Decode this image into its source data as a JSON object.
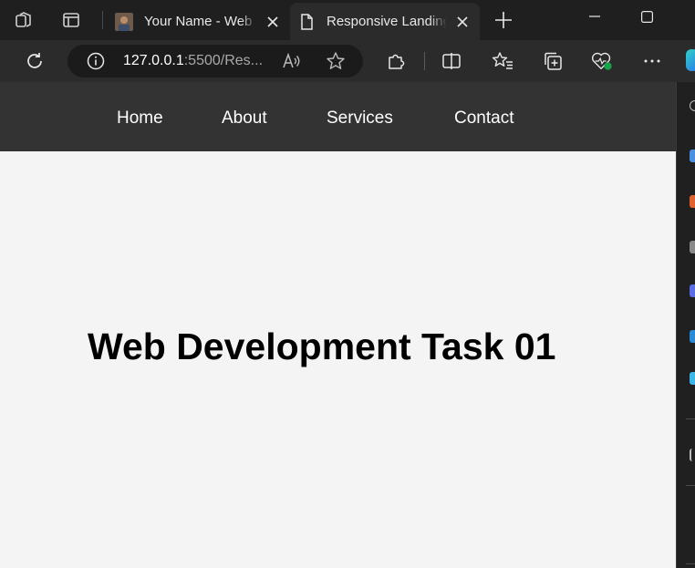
{
  "browser": {
    "tabs": [
      {
        "title": "Your Name - Web Developer",
        "active": false
      },
      {
        "title": "Responsive Landing Page",
        "active": true
      }
    ],
    "address": {
      "host": "127.0.0.1",
      "rest": ":5500/Res..."
    },
    "icons": [
      "workspaces-icon",
      "tab-actions-icon",
      "new-tab-icon",
      "minimize-icon",
      "maximize-icon",
      "close-window-icon",
      "refresh-icon",
      "site-info-icon",
      "read-aloud-icon",
      "favorite-star-icon",
      "extensions-icon",
      "split-screen-icon",
      "favorites-icon",
      "collections-icon",
      "browser-essentials-icon",
      "more-icon",
      "copilot-icon"
    ]
  },
  "site": {
    "nav": [
      "Home",
      "About",
      "Services",
      "Contact"
    ],
    "hero_title": "Web Development Task 01"
  },
  "colors": {
    "nav_bg": "#333333",
    "page_bg": "#f4f4f4",
    "browser_frame": "#1f1f1f",
    "toolbar": "#2b2b2b"
  }
}
